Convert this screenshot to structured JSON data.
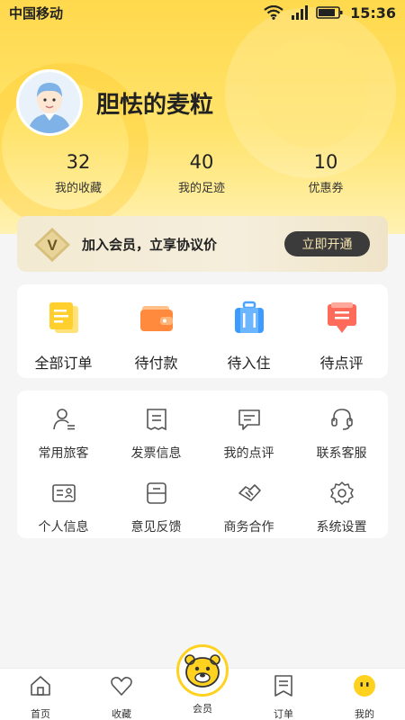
{
  "status_bar": {
    "carrier": "中国移动",
    "time": "15:36"
  },
  "profile": {
    "username": "胆怯的麦粒",
    "avatar_icon": "avatar-icon"
  },
  "stats": [
    {
      "value": "32",
      "label": "我的收藏"
    },
    {
      "value": "40",
      "label": "我的足迹"
    },
    {
      "value": "10",
      "label": "优惠券"
    }
  ],
  "member": {
    "badge": "V",
    "text": "加入会员，立享协议价",
    "button": "立即开通"
  },
  "orders": [
    {
      "label": "全部订单",
      "icon": "all-orders-icon"
    },
    {
      "label": "待付款",
      "icon": "wallet-icon"
    },
    {
      "label": "待入住",
      "icon": "luggage-icon"
    },
    {
      "label": "待点评",
      "icon": "review-icon"
    }
  ],
  "tools": [
    {
      "label": "常用旅客",
      "icon": "traveler-icon"
    },
    {
      "label": "发票信息",
      "icon": "invoice-icon"
    },
    {
      "label": "我的点评",
      "icon": "comment-icon"
    },
    {
      "label": "联系客服",
      "icon": "headset-icon"
    },
    {
      "label": "个人信息",
      "icon": "id-card-icon"
    },
    {
      "label": "意见反馈",
      "icon": "feedback-icon"
    },
    {
      "label": "商务合作",
      "icon": "handshake-icon"
    },
    {
      "label": "系统设置",
      "icon": "gear-icon"
    }
  ],
  "nav": [
    {
      "label": "首页",
      "icon": "home-icon"
    },
    {
      "label": "收藏",
      "icon": "heart-icon"
    },
    {
      "label": "会员",
      "icon": "mascot-icon"
    },
    {
      "label": "订单",
      "icon": "order-icon"
    },
    {
      "label": "我的",
      "icon": "me-icon"
    }
  ],
  "colors": {
    "accent": "#ffd21f",
    "header": "#ffe36b",
    "member_button": "#3b3b3b"
  }
}
